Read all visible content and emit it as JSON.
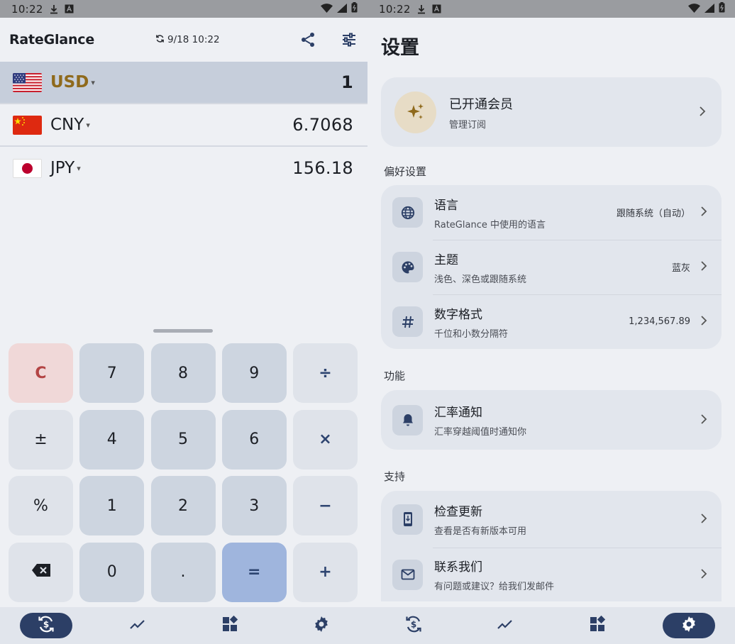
{
  "status_bar": {
    "time": "10:22"
  },
  "converter": {
    "app_title": "RateGlance",
    "updated": "9/18 10:22",
    "rows": [
      {
        "code": "USD",
        "value": "1",
        "flag": "us"
      },
      {
        "code": "CNY",
        "value": "6.7068",
        "flag": "cn"
      },
      {
        "code": "JPY",
        "value": "156.18",
        "flag": "jp"
      }
    ],
    "dropdown_glyph": "▾",
    "keys": [
      "C",
      "7",
      "8",
      "9",
      "÷",
      "±",
      "4",
      "5",
      "6",
      "×",
      "%",
      "1",
      "2",
      "3",
      "−",
      "⌫",
      "0",
      ".",
      "=",
      "+"
    ]
  },
  "settings": {
    "title": "设置",
    "member": {
      "title": "已开通会员",
      "subtitle": "管理订阅"
    },
    "sections": {
      "preferences": "偏好设置",
      "features": "功能",
      "support": "支持"
    },
    "preferences": [
      {
        "title": "语言",
        "subtitle": "RateGlance 中使用的语言",
        "value": "跟随系统（自动）",
        "icon": "globe-icon"
      },
      {
        "title": "主题",
        "subtitle": "浅色、深色或跟随系统",
        "value": "蓝灰",
        "icon": "palette-icon"
      },
      {
        "title": "数字格式",
        "subtitle": "千位和小数分隔符",
        "value": "1,234,567.89",
        "icon": "hash-icon"
      }
    ],
    "features": [
      {
        "title": "汇率通知",
        "subtitle": "汇率穿越阈值时通知你",
        "icon": "bell-icon"
      }
    ],
    "support": [
      {
        "title": "检查更新",
        "subtitle": "查看是否有新版本可用",
        "icon": "phone-update-icon"
      },
      {
        "title": "联系我们",
        "subtitle": "有问题或建议？给我们发邮件",
        "icon": "mail-icon"
      }
    ]
  },
  "colors": {
    "accent": "#2c3f66",
    "gold": "#8f6a1c",
    "clear_key": "#b34444"
  }
}
